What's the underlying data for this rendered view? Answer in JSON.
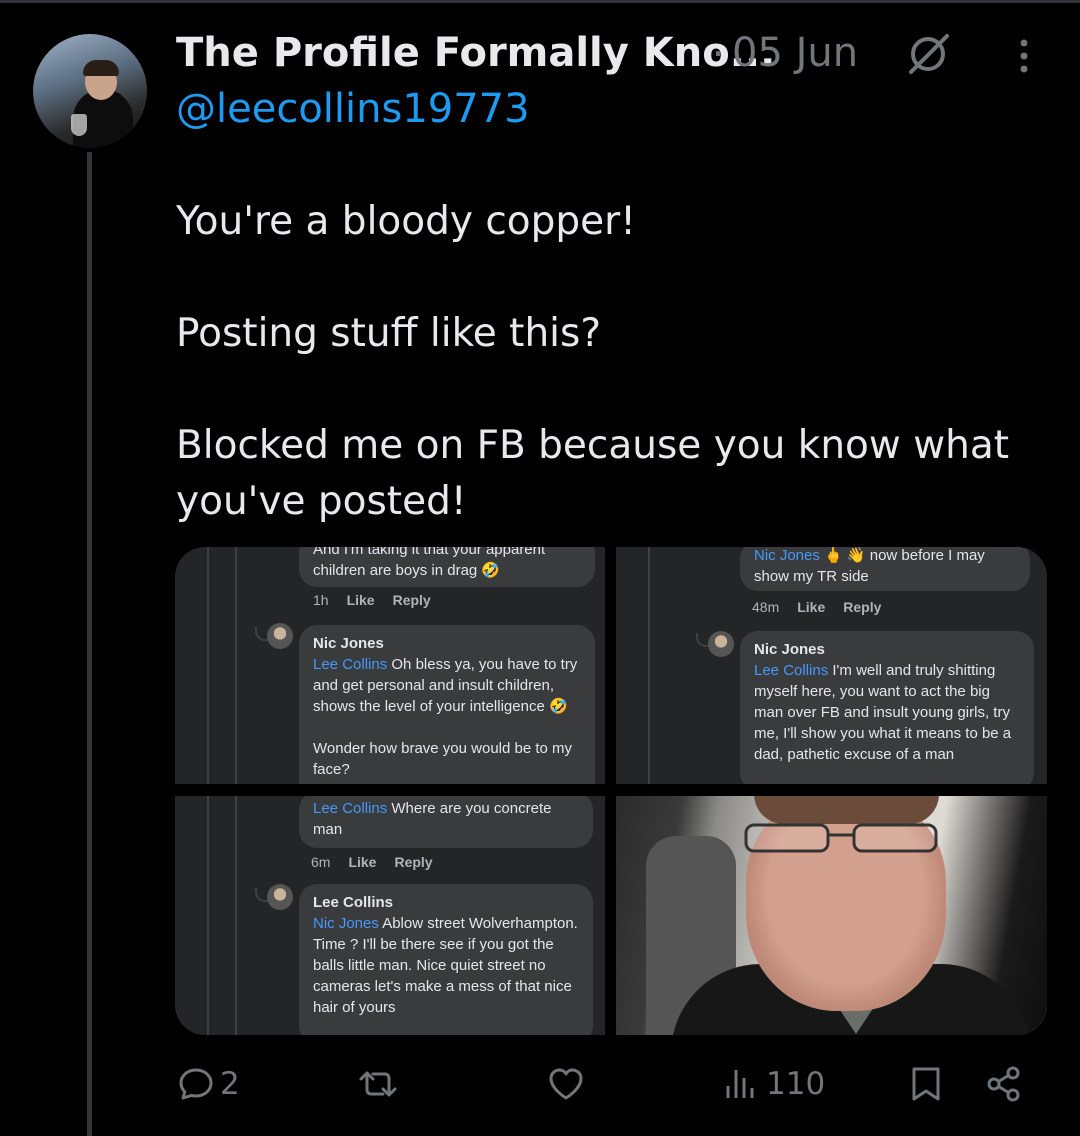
{
  "post": {
    "author_name": "The Profile Formally Kno...",
    "separator": "·",
    "date": "05 Jun",
    "handle": "@leecollins19773",
    "text": [
      "You're a bloody copper!",
      "Posting stuff like this?",
      "Blocked me on FB because you know what you've posted!"
    ]
  },
  "media": {
    "tile1": {
      "top_comment": "And I'm taking it that your apparent children are boys in drag 🤣",
      "top_meta_time": "1h",
      "top_meta_like": "Like",
      "top_meta_reply": "Reply",
      "reply_name": "Nic Jones",
      "reply_tag": "Lee Collins",
      "reply_text": " Oh bless ya, you have to try and get personal and insult children, shows the level of your intelligence 🤣",
      "reply_text2": "Wonder how brave you would be to my face?"
    },
    "tile2": {
      "top_tag": "Nic Jones",
      "top_emoji": " 🖕 👋",
      "top_text": " now before I may show my TR side",
      "top_meta_time": "48m",
      "top_meta_like": "Like",
      "top_meta_reply": "Reply",
      "reply_name": "Nic Jones",
      "reply_tag": "Lee Collins",
      "reply_text": " I'm well and truly shitting myself here, you want to act the big man over FB and insult young girls, try me, I'll show you what it means to be a dad, pathetic excuse of a man"
    },
    "tile3": {
      "top_tag": "Lee Collins",
      "top_text": " Where are you concrete man",
      "top_meta_time": "6m",
      "top_meta_like": "Like",
      "top_meta_reply": "Reply",
      "reply_name": "Lee Collins",
      "reply_tag": "Nic Jones",
      "reply_text": " Ablow street Wolverhampton. Time ? I'll be there see if you got the balls little man. Nice quiet street no cameras let's make a mess of that nice hair of yours"
    }
  },
  "actions": {
    "replies": "2",
    "reposts": "",
    "likes": "",
    "views": "110"
  },
  "colors": {
    "background": "#000000",
    "text": "#e7e9ea",
    "muted": "#71767b",
    "accent": "#1d9bf0",
    "fb_tag": "#4599ff"
  }
}
